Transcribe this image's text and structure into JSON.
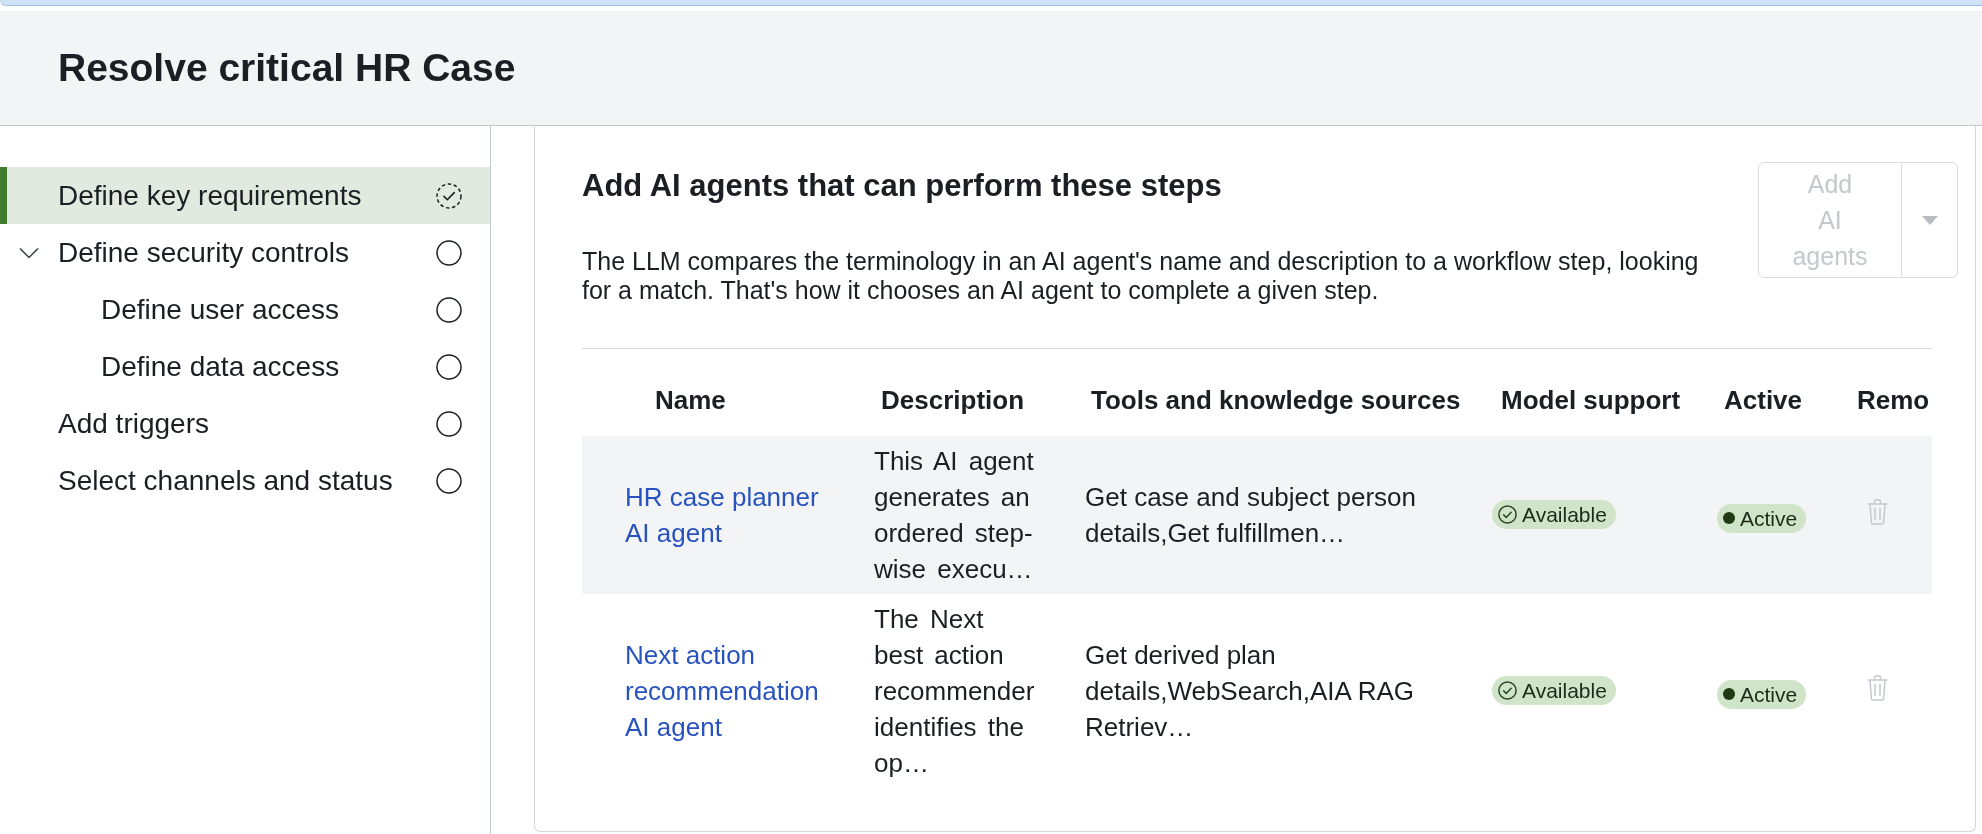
{
  "page": {
    "title": "Resolve critical HR Case"
  },
  "steps": [
    {
      "label": "Define key requirements",
      "selected": true,
      "in_progress": true
    },
    {
      "label": "Define security controls",
      "selected": false,
      "in_progress": false,
      "expanded": true,
      "children": [
        {
          "label": "Define user access",
          "selected": false,
          "in_progress": false
        },
        {
          "label": "Define data access",
          "selected": false,
          "in_progress": false
        }
      ]
    },
    {
      "label": "Add triggers",
      "selected": false,
      "in_progress": false
    },
    {
      "label": "Select channels and status",
      "selected": false,
      "in_progress": false
    }
  ],
  "agents_section": {
    "heading": "Add AI agents that can perform these steps",
    "description": "The LLM compares the terminology in an AI agent's name and description to a workflow step, looking for a match. That's how it chooses an AI agent to complete a given step.",
    "add_button": {
      "label": "Add AI agents",
      "disabled": true
    },
    "table": {
      "columns": [
        "Name",
        "Description",
        "Tools and knowledge sources",
        "Model support",
        "Active",
        "Remo"
      ],
      "rows": [
        {
          "name": "HR case planner AI agent",
          "description": "This AI agent generates an ordered step-wise execu…",
          "tools": "Get case and subject person details,Get fulfillmen…",
          "model_support": "Available",
          "active": "Active",
          "remove": {
            "disabled": true
          }
        },
        {
          "name": "Next action recommendation AI agent",
          "description": "The Next best action recommender identifies the op…",
          "tools": "Get derived plan details,WebSearch,AIA RAG Retriev…",
          "model_support": "Available",
          "active": "Active",
          "remove": {
            "disabled": true
          }
        }
      ]
    }
  }
}
